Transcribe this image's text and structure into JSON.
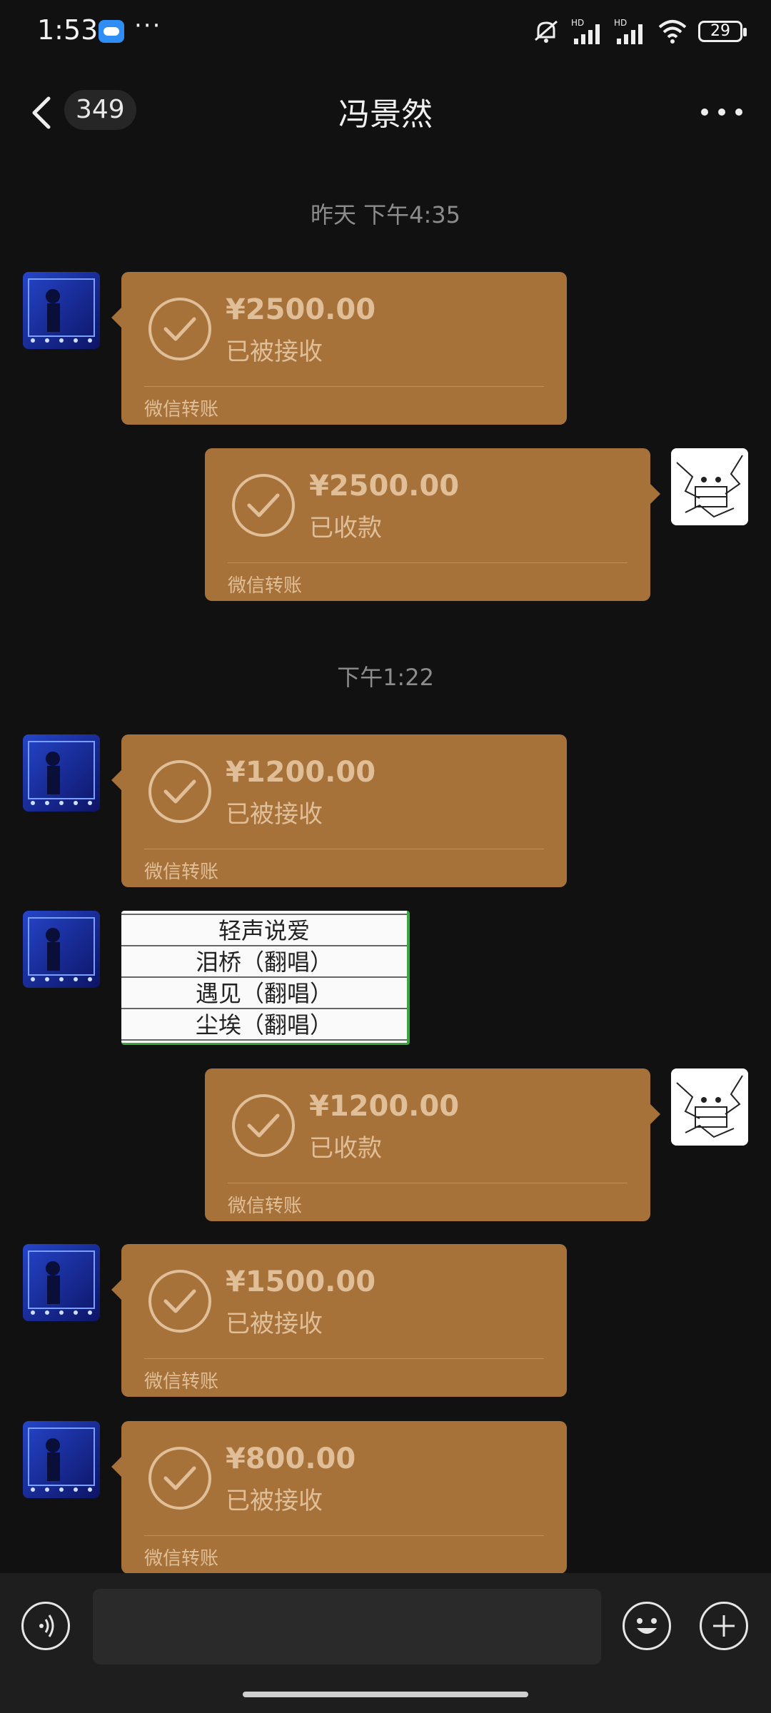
{
  "status_bar": {
    "time": "1:53",
    "more": "···",
    "signal_1_label": "HD",
    "signal_2_label": "HD",
    "battery": "29"
  },
  "header": {
    "unread_count": "349",
    "title": "冯景然"
  },
  "time_labels": [
    "昨天 下午4:35",
    "下午1:22"
  ],
  "transfers": [
    {
      "amount": "¥2500.00",
      "status": "已被接收",
      "footer": "微信转账"
    },
    {
      "amount": "¥2500.00",
      "status": "已收款",
      "footer": "微信转账"
    },
    {
      "amount": "¥1200.00",
      "status": "已被接收",
      "footer": "微信转账"
    },
    {
      "amount": "¥1200.00",
      "status": "已收款",
      "footer": "微信转账"
    },
    {
      "amount": "¥1500.00",
      "status": "已被接收",
      "footer": "微信转账"
    },
    {
      "amount": "¥800.00",
      "status": "已被接收",
      "footer": "微信转账"
    }
  ],
  "song_image": {
    "rows": [
      "轻声说爱",
      "泪桥（翻唱）",
      "遇见（翻唱）",
      "尘埃（翻唱）"
    ]
  },
  "input": {
    "placeholder": ""
  },
  "colors": {
    "background": "#111111",
    "transfer_bubble": "#a6723a",
    "transfer_text": "#e0bf98",
    "input_bar": "#1e1e1e"
  },
  "icons": [
    "cloud-icon",
    "mute-icon",
    "signal-icon",
    "wifi-icon",
    "battery-icon",
    "back-arrow-icon",
    "more-icon",
    "check-circle-icon",
    "voice-icon",
    "emoji-icon",
    "plus-icon"
  ]
}
